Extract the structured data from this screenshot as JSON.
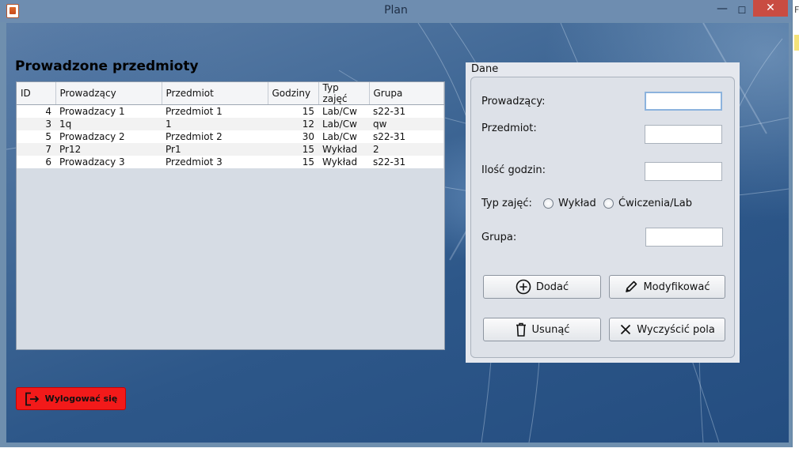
{
  "window": {
    "title": "Plan",
    "minimize_glyph": "—",
    "maximize_glyph": "☐",
    "close_glyph": "✕"
  },
  "heading": "Prowadzone przedmioty",
  "table": {
    "columns": [
      "ID",
      "Prowadzący",
      "Przedmiot",
      "Godziny",
      "Typ zajęć",
      "Grupa"
    ],
    "rows": [
      [
        "4",
        "Prowadzacy 1",
        "Przedmiot 1",
        "15",
        "Lab/Cw",
        "s22-31"
      ],
      [
        "3",
        "1q",
        "1",
        "12",
        "Lab/Cw",
        "qw"
      ],
      [
        "5",
        "Prowadzacy 2",
        "Przedmiot 2",
        "30",
        "Lab/Cw",
        "s22-31"
      ],
      [
        "7",
        "Pr12",
        "Pr1",
        "15",
        "Wykład",
        "2"
      ],
      [
        "6",
        "Prowadzacy 3",
        "Przedmiot 3",
        "15",
        "Wykład",
        "s22-31"
      ]
    ]
  },
  "form": {
    "title": "Dane",
    "prowadzacy_label": "Prowadzący:",
    "prowadzacy_value": "",
    "przedmiot_label": "Przedmiot:",
    "przedmiot_value": "",
    "godziny_label": "Ilość godzin:",
    "godziny_value": "",
    "typ_label": "Typ zajęć:",
    "typ_options": [
      "Wykład",
      "Ćwiczenia/Lab"
    ],
    "grupa_label": "Grupa:",
    "grupa_value": ""
  },
  "buttons": {
    "add": "Dodać",
    "modify": "Modyfikować",
    "delete": "Usunąć",
    "clear": "Wyczyścić pola",
    "logout": "Wylogować się"
  },
  "edge_text": "F",
  "colors": {
    "logout_bg": "#f21a1a",
    "titlebar": "#6e8db0",
    "close_button": "#c94c42"
  },
  "icons": {
    "add": "plus-circle-icon",
    "modify": "pencil-icon",
    "delete": "trash-icon",
    "clear": "x-icon",
    "logout": "logout-icon"
  }
}
